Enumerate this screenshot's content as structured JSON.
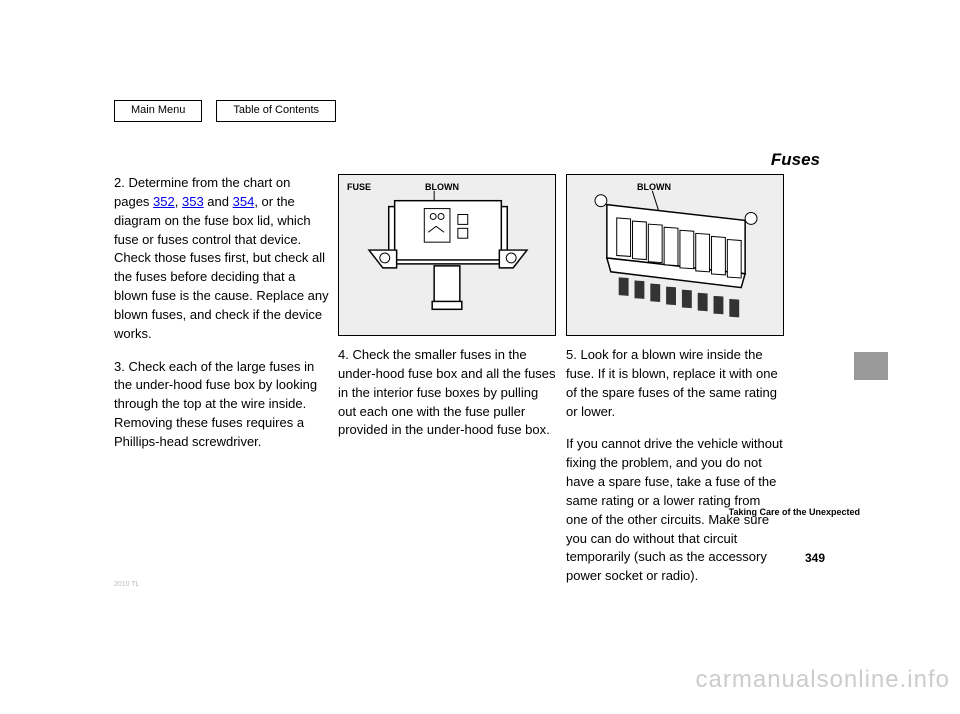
{
  "nav": {
    "main_menu": "Main Menu",
    "toc": "Table of Contents"
  },
  "title": "Fuses",
  "col1": {
    "step2": {
      "num": "2.",
      "text": "Determine from the chart on pages",
      "link1": "352",
      "link2": "353",
      "link_sep": ", ",
      "and": " and ",
      "link3": "354",
      "text2": ", or the diagram on the fuse box lid, which fuse or fuses control that device. Check those fuses first, but check all the fuses before deciding that a blown fuse is the cause. Replace any blown fuses, and check if the device works."
    },
    "step3": {
      "num": "3.",
      "text": "Check each of the large fuses in the under-hood fuse box by looking through the top at the wire inside. Removing these fuses requires a Phillips-head screwdriver."
    }
  },
  "col2": {
    "d_label_fuse": "FUSE",
    "d_label_blown": "BLOWN",
    "step4": {
      "num": "4.",
      "text": "Check the smaller fuses in the under-hood fuse box and all the fuses in the interior fuse boxes by pulling out each one with the fuse puller provided in the under-hood fuse box."
    }
  },
  "col3": {
    "d_label_blown": "BLOWN",
    "step5": {
      "num": "5.",
      "text": "Look for a blown wire inside the fuse. If it is blown, replace it with one of the spare fuses of the same rating or lower."
    },
    "note": "If you cannot drive the vehicle without fixing the problem, and you do not have a spare fuse, take a fuse of the same rating or a lower rating from one of the other circuits. Make sure you can do without that circuit temporarily (such as the accessory power socket or radio)."
  },
  "side_label": "Taking Care of the Unexpected",
  "page_num": "349",
  "watermark": "carmanualsonline.info",
  "year_line": "2010 TL"
}
